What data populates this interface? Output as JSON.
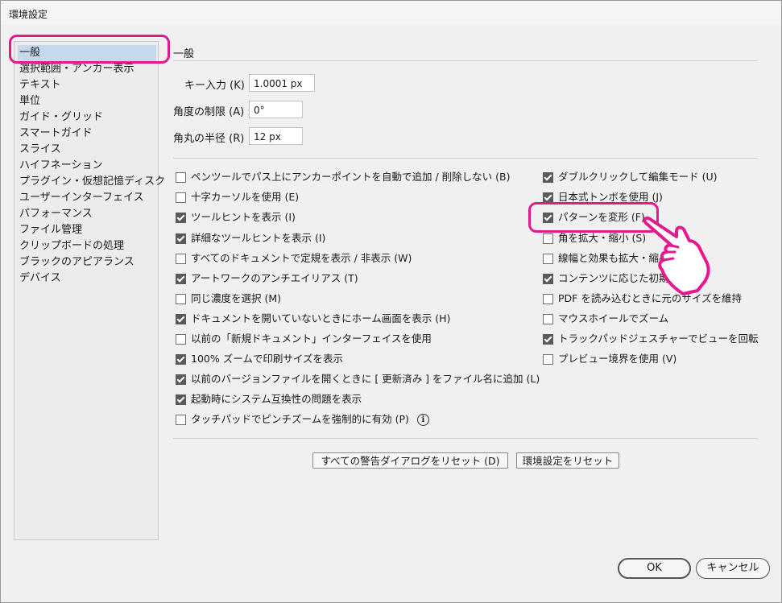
{
  "window": {
    "title": "環境設定"
  },
  "sidebar": {
    "items": [
      {
        "label": "一般",
        "selected": true
      },
      {
        "label": "選択範囲・アンカー表示"
      },
      {
        "label": "テキスト"
      },
      {
        "label": "単位"
      },
      {
        "label": "ガイド・グリッド"
      },
      {
        "label": "スマートガイド"
      },
      {
        "label": "スライス"
      },
      {
        "label": "ハイフネーション"
      },
      {
        "label": "プラグイン・仮想記憶ディスク"
      },
      {
        "label": "ユーザーインターフェイス"
      },
      {
        "label": "パフォーマンス"
      },
      {
        "label": "ファイル管理"
      },
      {
        "label": "クリップボードの処理"
      },
      {
        "label": "ブラックのアピアランス"
      },
      {
        "label": "デバイス"
      }
    ]
  },
  "main": {
    "section_title": "一般",
    "fields": {
      "key_input_label": "キー入力 (K) :",
      "key_input_value": "1.0001 px",
      "angle_label": "角度の制限 (A) :",
      "angle_value": "0°",
      "corner_label": "角丸の半径 (R) :",
      "corner_value": "12 px"
    },
    "left_options": [
      {
        "label": "ペンツールでパス上にアンカーポイントを自動で追加 / 削除しない (B)",
        "checked": false
      },
      {
        "label": "十字カーソルを使用 (E)",
        "checked": false
      },
      {
        "label": "ツールヒントを表示 (I)",
        "checked": true
      },
      {
        "label": "詳細なツールヒントを表示 (I)",
        "checked": true
      },
      {
        "label": "すべてのドキュメントで定規を表示 / 非表示 (W)",
        "checked": false
      },
      {
        "label": "アートワークのアンチエイリアス (T)",
        "checked": true
      },
      {
        "label": "同じ濃度を選択 (M)",
        "checked": false
      },
      {
        "label": "ドキュメントを開いていないときにホーム画面を表示 (H)",
        "checked": true
      },
      {
        "label": "以前の「新規ドキュメント」インターフェイスを使用",
        "checked": false
      },
      {
        "label": "100% ズームで印刷サイズを表示",
        "checked": true
      },
      {
        "label": "以前のバージョンファイルを開くときに [ 更新済み ] をファイル名に追加 (L)",
        "checked": true
      },
      {
        "label": "起動時にシステム互換性の問題を表示",
        "checked": true
      },
      {
        "label": "タッチパッドでピンチズームを強制的に有効 (P)",
        "checked": false,
        "info": "i"
      }
    ],
    "right_options": [
      {
        "label": "ダブルクリックして編集モード (U)",
        "checked": true
      },
      {
        "label": "日本式トンボを使用 (J)",
        "checked": true
      },
      {
        "label": "パターンを変形 (F)",
        "checked": true
      },
      {
        "label": "角を拡大・縮小 (S)",
        "checked": false
      },
      {
        "label": "線幅と効果も拡大・縮小 (O)",
        "checked": false
      },
      {
        "label": "コンテンツに応じた初期設定",
        "checked": true
      },
      {
        "label": "PDF を読み込むときに元のサイズを維持",
        "checked": false
      },
      {
        "label": "マウスホイールでズーム",
        "checked": false
      },
      {
        "label": "トラックパッドジェスチャーでビューを回転",
        "checked": true
      },
      {
        "label": "プレビュー境界を使用 (V)",
        "checked": false
      }
    ],
    "reset_warnings_label": "すべての警告ダイアログをリセット (D)",
    "reset_prefs_label": "環境設定をリセット"
  },
  "footer": {
    "ok_label": "OK",
    "cancel_label": "キャンセル"
  },
  "colors": {
    "highlight": "#e5198f",
    "selection": "#c6d8ec"
  }
}
